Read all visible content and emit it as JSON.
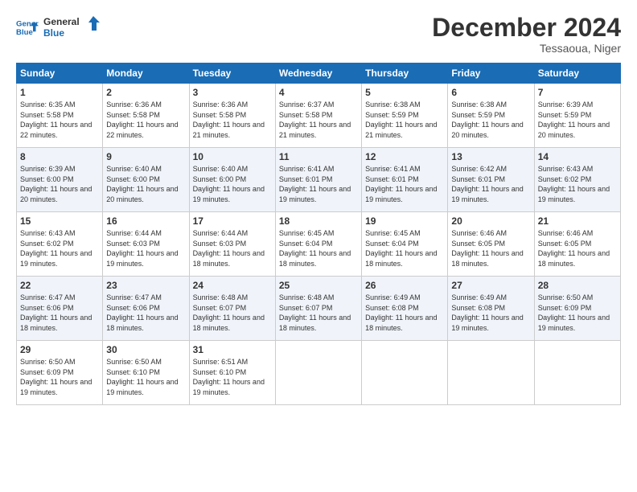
{
  "logo": {
    "line1": "General",
    "line2": "Blue"
  },
  "title": "December 2024",
  "location": "Tessaoua, Niger",
  "days_of_week": [
    "Sunday",
    "Monday",
    "Tuesday",
    "Wednesday",
    "Thursday",
    "Friday",
    "Saturday"
  ],
  "weeks": [
    [
      {
        "day": "1",
        "sunrise": "Sunrise: 6:35 AM",
        "sunset": "Sunset: 5:58 PM",
        "daylight": "Daylight: 11 hours and 22 minutes."
      },
      {
        "day": "2",
        "sunrise": "Sunrise: 6:36 AM",
        "sunset": "Sunset: 5:58 PM",
        "daylight": "Daylight: 11 hours and 22 minutes."
      },
      {
        "day": "3",
        "sunrise": "Sunrise: 6:36 AM",
        "sunset": "Sunset: 5:58 PM",
        "daylight": "Daylight: 11 hours and 21 minutes."
      },
      {
        "day": "4",
        "sunrise": "Sunrise: 6:37 AM",
        "sunset": "Sunset: 5:58 PM",
        "daylight": "Daylight: 11 hours and 21 minutes."
      },
      {
        "day": "5",
        "sunrise": "Sunrise: 6:38 AM",
        "sunset": "Sunset: 5:59 PM",
        "daylight": "Daylight: 11 hours and 21 minutes."
      },
      {
        "day": "6",
        "sunrise": "Sunrise: 6:38 AM",
        "sunset": "Sunset: 5:59 PM",
        "daylight": "Daylight: 11 hours and 20 minutes."
      },
      {
        "day": "7",
        "sunrise": "Sunrise: 6:39 AM",
        "sunset": "Sunset: 5:59 PM",
        "daylight": "Daylight: 11 hours and 20 minutes."
      }
    ],
    [
      {
        "day": "8",
        "sunrise": "Sunrise: 6:39 AM",
        "sunset": "Sunset: 6:00 PM",
        "daylight": "Daylight: 11 hours and 20 minutes."
      },
      {
        "day": "9",
        "sunrise": "Sunrise: 6:40 AM",
        "sunset": "Sunset: 6:00 PM",
        "daylight": "Daylight: 11 hours and 20 minutes."
      },
      {
        "day": "10",
        "sunrise": "Sunrise: 6:40 AM",
        "sunset": "Sunset: 6:00 PM",
        "daylight": "Daylight: 11 hours and 19 minutes."
      },
      {
        "day": "11",
        "sunrise": "Sunrise: 6:41 AM",
        "sunset": "Sunset: 6:01 PM",
        "daylight": "Daylight: 11 hours and 19 minutes."
      },
      {
        "day": "12",
        "sunrise": "Sunrise: 6:41 AM",
        "sunset": "Sunset: 6:01 PM",
        "daylight": "Daylight: 11 hours and 19 minutes."
      },
      {
        "day": "13",
        "sunrise": "Sunrise: 6:42 AM",
        "sunset": "Sunset: 6:01 PM",
        "daylight": "Daylight: 11 hours and 19 minutes."
      },
      {
        "day": "14",
        "sunrise": "Sunrise: 6:43 AM",
        "sunset": "Sunset: 6:02 PM",
        "daylight": "Daylight: 11 hours and 19 minutes."
      }
    ],
    [
      {
        "day": "15",
        "sunrise": "Sunrise: 6:43 AM",
        "sunset": "Sunset: 6:02 PM",
        "daylight": "Daylight: 11 hours and 19 minutes."
      },
      {
        "day": "16",
        "sunrise": "Sunrise: 6:44 AM",
        "sunset": "Sunset: 6:03 PM",
        "daylight": "Daylight: 11 hours and 19 minutes."
      },
      {
        "day": "17",
        "sunrise": "Sunrise: 6:44 AM",
        "sunset": "Sunset: 6:03 PM",
        "daylight": "Daylight: 11 hours and 18 minutes."
      },
      {
        "day": "18",
        "sunrise": "Sunrise: 6:45 AM",
        "sunset": "Sunset: 6:04 PM",
        "daylight": "Daylight: 11 hours and 18 minutes."
      },
      {
        "day": "19",
        "sunrise": "Sunrise: 6:45 AM",
        "sunset": "Sunset: 6:04 PM",
        "daylight": "Daylight: 11 hours and 18 minutes."
      },
      {
        "day": "20",
        "sunrise": "Sunrise: 6:46 AM",
        "sunset": "Sunset: 6:05 PM",
        "daylight": "Daylight: 11 hours and 18 minutes."
      },
      {
        "day": "21",
        "sunrise": "Sunrise: 6:46 AM",
        "sunset": "Sunset: 6:05 PM",
        "daylight": "Daylight: 11 hours and 18 minutes."
      }
    ],
    [
      {
        "day": "22",
        "sunrise": "Sunrise: 6:47 AM",
        "sunset": "Sunset: 6:06 PM",
        "daylight": "Daylight: 11 hours and 18 minutes."
      },
      {
        "day": "23",
        "sunrise": "Sunrise: 6:47 AM",
        "sunset": "Sunset: 6:06 PM",
        "daylight": "Daylight: 11 hours and 18 minutes."
      },
      {
        "day": "24",
        "sunrise": "Sunrise: 6:48 AM",
        "sunset": "Sunset: 6:07 PM",
        "daylight": "Daylight: 11 hours and 18 minutes."
      },
      {
        "day": "25",
        "sunrise": "Sunrise: 6:48 AM",
        "sunset": "Sunset: 6:07 PM",
        "daylight": "Daylight: 11 hours and 18 minutes."
      },
      {
        "day": "26",
        "sunrise": "Sunrise: 6:49 AM",
        "sunset": "Sunset: 6:08 PM",
        "daylight": "Daylight: 11 hours and 18 minutes."
      },
      {
        "day": "27",
        "sunrise": "Sunrise: 6:49 AM",
        "sunset": "Sunset: 6:08 PM",
        "daylight": "Daylight: 11 hours and 19 minutes."
      },
      {
        "day": "28",
        "sunrise": "Sunrise: 6:50 AM",
        "sunset": "Sunset: 6:09 PM",
        "daylight": "Daylight: 11 hours and 19 minutes."
      }
    ],
    [
      {
        "day": "29",
        "sunrise": "Sunrise: 6:50 AM",
        "sunset": "Sunset: 6:09 PM",
        "daylight": "Daylight: 11 hours and 19 minutes."
      },
      {
        "day": "30",
        "sunrise": "Sunrise: 6:50 AM",
        "sunset": "Sunset: 6:10 PM",
        "daylight": "Daylight: 11 hours and 19 minutes."
      },
      {
        "day": "31",
        "sunrise": "Sunrise: 6:51 AM",
        "sunset": "Sunset: 6:10 PM",
        "daylight": "Daylight: 11 hours and 19 minutes."
      },
      null,
      null,
      null,
      null
    ]
  ]
}
